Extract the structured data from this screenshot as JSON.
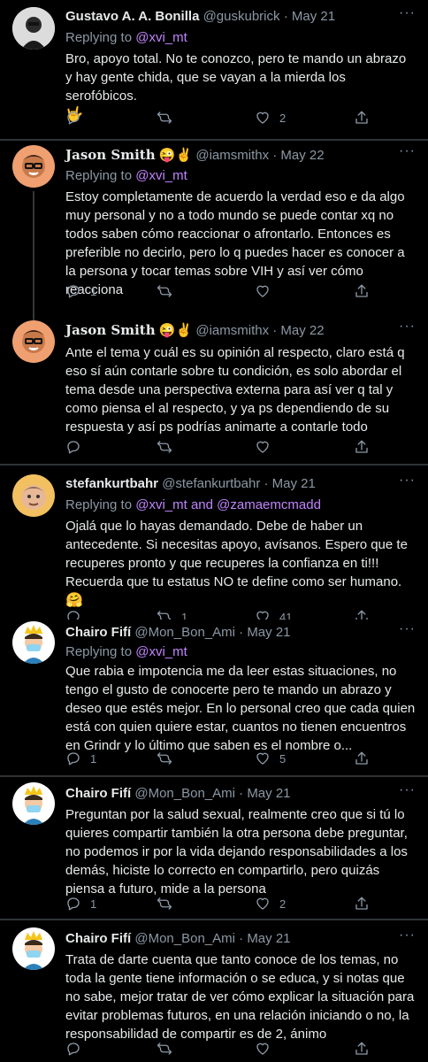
{
  "tweets": [
    {
      "name": "Gustavo A. A. Bonilla",
      "handle": "@guskubrick",
      "date": "May 21",
      "replying_label": "Replying to",
      "replying_to": "@xvi_mt",
      "text": "Bro, apoyo total. No te conozco, pero te mando un abrazo y hay gente chida, que se vayan a la mierda los serofóbicos.",
      "emoji": "🤟",
      "counts": {
        "replies": "",
        "retweets": "",
        "likes": "2"
      }
    },
    {
      "name": "Jason Smith",
      "name_emoji": "😜✌️",
      "handle": "@iamsmithx",
      "date": "May 22",
      "replying_label": "Replying to",
      "replying_to": "@xvi_mt",
      "text": "Estoy completamente de acuerdo la verdad eso e da algo muy personal y no a todo mundo se puede contar xq no todos saben cómo reaccionar o afrontarlo. Entonces es preferible no decirlo, pero lo q puedes hacer es conocer a la persona y tocar temas sobre VIH y así ver cómo reacciona",
      "counts": {
        "replies": "1",
        "retweets": "",
        "likes": ""
      }
    },
    {
      "name": "Jason Smith",
      "name_emoji": "😜✌️",
      "handle": "@iamsmithx",
      "date": "May 22",
      "text": "Ante el tema y cuál es su opinión al respecto, claro está q eso sí aún contarle sobre tu condición, es solo abordar el tema desde una perspectiva externa para así ver q tal y como piensa el al respecto, y ya ps dependiendo de su respuesta y así ps podrías animarte a contarle todo",
      "counts": {
        "replies": "",
        "retweets": "",
        "likes": ""
      }
    },
    {
      "name": "stefankurtbahr",
      "handle": "@stefankurtbahr",
      "date": "May 21",
      "replying_label": "Replying to",
      "replying_to": "@xvi_mt and @zamaemcmadd",
      "text": "Ojalá que lo hayas demandado. Debe de haber un antecedente. Si necesitas apoyo, avísanos. Espero que te recuperes pronto y que recuperes la confianza en ti!!! Recuerda que tu estatus NO te define como ser humano.",
      "emoji": "🤗",
      "counts": {
        "replies": "",
        "retweets": "1",
        "likes": "41"
      }
    },
    {
      "name": "Chairo Fifí",
      "handle": "@Mon_Bon_Ami",
      "date": "May 21",
      "replying_label": "Replying to",
      "replying_to": "@xvi_mt",
      "text": "Que rabia e impotencia me da leer estas situaciones, no tengo el gusto de conocerte pero te mando un abrazo y deseo que estés mejor. En lo personal creo que cada quien está con quien quiere estar, cuantos no tienen encuentros en Grindr y lo último que saben es el nombre o...",
      "counts": {
        "replies": "1",
        "retweets": "",
        "likes": "5"
      }
    },
    {
      "name": "Chairo Fifí",
      "handle": "@Mon_Bon_Ami",
      "date": "May 21",
      "text": "Preguntan por la salud sexual, realmente creo que si tú lo quieres compartir también la otra persona debe preguntar, no podemos ir por la vida dejando responsabilidades a los demás, hiciste lo correcto en compartirlo, pero quizás piensa a futuro, mide a la persona",
      "counts": {
        "replies": "1",
        "retweets": "",
        "likes": "2"
      }
    },
    {
      "name": "Chairo Fifí",
      "handle": "@Mon_Bon_Ami",
      "date": "May 21",
      "text": "Trata de darte cuenta que tanto conoce de los temas, no toda la gente tiene información o se educa, y si notas que no sabe, mejor tratar de ver cómo explicar la situación para evitar problemas futuros, en una relación iniciando o no, la responsabilidad de compartir es de 2, ánimo",
      "counts": {
        "replies": "",
        "retweets": "",
        "likes": ""
      }
    }
  ],
  "ui": {
    "dot": "·",
    "more": "···"
  },
  "colors": {
    "background": "#000000",
    "separator": "#2f3336",
    "mention": "#c084fc",
    "secondary_text": "#8b98a5"
  }
}
